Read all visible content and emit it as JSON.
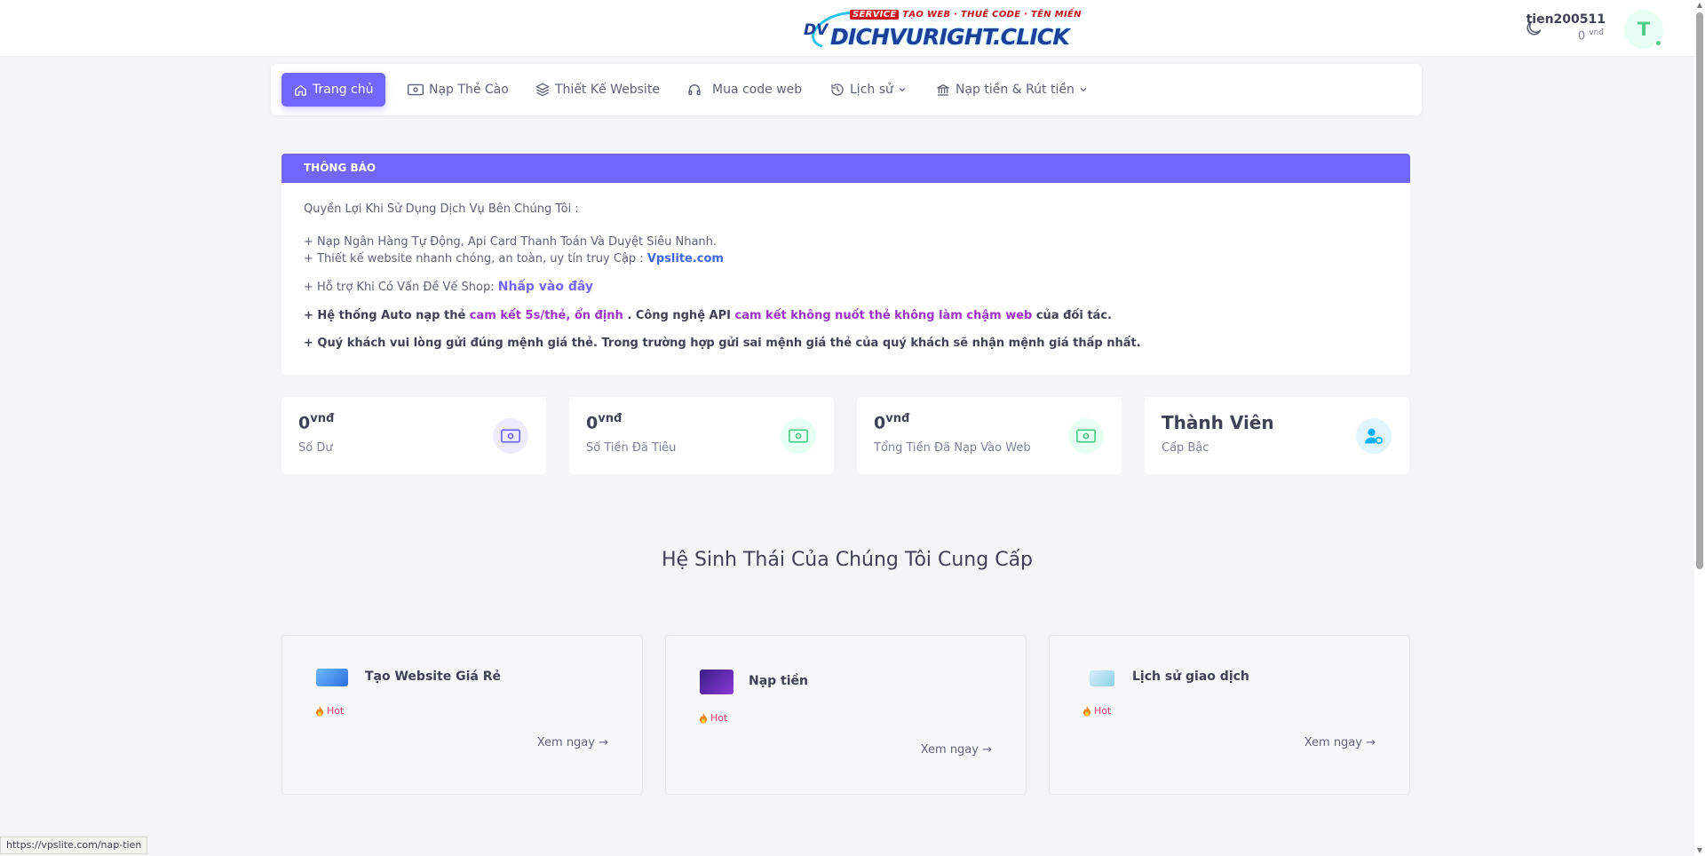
{
  "brand": {
    "badge": "SERVICE",
    "tag_text": "TẠO WEB · THUÊ CODE · TÊN MIỀN",
    "mark": "DV",
    "word": "DICHVURIGHT.CLICK"
  },
  "user": {
    "name": "tien200511",
    "balance": "0",
    "currency": "vnđ",
    "avatar_letter": "T"
  },
  "nav": {
    "home": "Trang chủ",
    "topup_card": "Nạp Thẻ Cào",
    "website_design": "Thiết Kế Website",
    "buy_code": "Mua code web",
    "history": "Lịch sử",
    "deposit_withdraw": "Nạp tiền & Rút tiền"
  },
  "notice": {
    "header": "THÔNG BÁO",
    "line1": "Quyền Lợi Khi Sử Dụng Dịch Vụ Bên Chúng Tôi :",
    "line2": "+ Nạp Ngân Hàng Tự Động, Api Card Thanh Toán Và Duyệt Siêu Nhanh.",
    "line3_prefix": "+ Thiết kế website nhanh chóng, an toàn, uy tín truy Cập : ",
    "line3_link": "Vpslite.com",
    "line4_prefix": "+ Hỗ trợ Khi Có Vấn Đề Vế Shop: ",
    "line4_link": "Nhấp vào đây",
    "line5_a": "+ Hệ thống Auto nạp thẻ ",
    "line5_b": "cam kết 5s/thẻ, ổn định",
    "line5_c": " . Công nghệ API ",
    "line5_d": "cam kết không nuốt thẻ không làm chậm web",
    "line5_e": " của đối tác.",
    "line6": "+ Quý khách vui lòng gửi đúng mệnh giá thẻ. Trong trường hợp gửi sai mệnh giá thẻ của quý khách sẽ nhận mệnh giá thấp nhất."
  },
  "stats": [
    {
      "value": "0",
      "unit": "vnđ",
      "label": "Số Dư"
    },
    {
      "value": "0",
      "unit": "vnđ",
      "label": "Số Tiền Đã Tiêu"
    },
    {
      "value": "0",
      "unit": "vnđ",
      "label": "Tổng Tiền Đã Nạp Vào Web"
    },
    {
      "value": "Thành Viên",
      "unit": "",
      "label": "Cấp Bậc"
    }
  ],
  "section_title": "Hệ Sinh Thái Của Chúng Tôi Cung Cấp",
  "features": [
    {
      "title": "Tạo Website Giá Rẻ",
      "badge": "Hot",
      "cta": "Xem ngay →"
    },
    {
      "title": "Nạp tiền",
      "badge": "Hot",
      "cta": "Xem ngay →"
    },
    {
      "title": "Lịch sử giao dịch",
      "badge": "Hot",
      "cta": "Xem ngay →"
    }
  ],
  "status_url": "https://vpslite.com/nap-tien",
  "colors": {
    "primary": "#7366ff",
    "success": "#50cd89",
    "info": "#00b2ff",
    "danger": "#f1416c"
  }
}
